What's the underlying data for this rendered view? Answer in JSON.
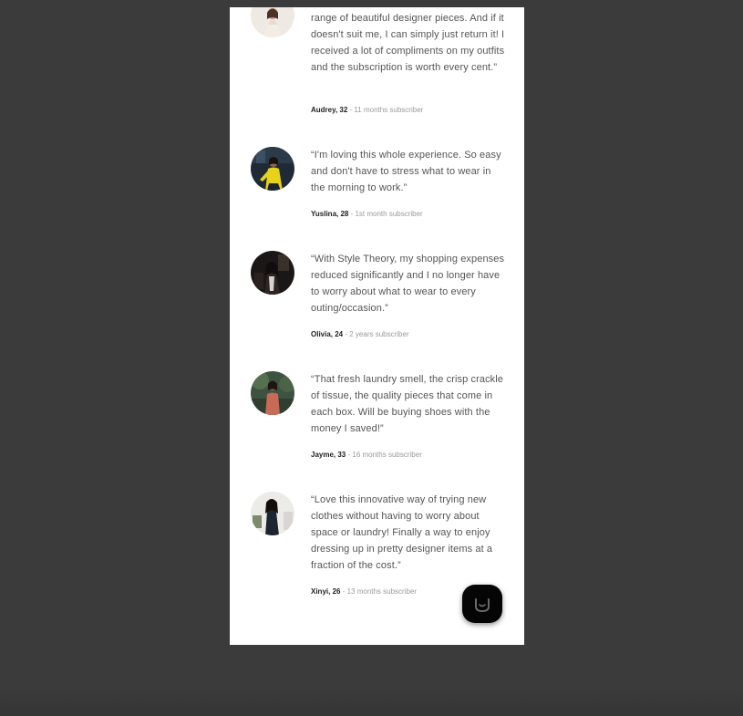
{
  "reviews": [
    {
      "quote": "range of beautiful designer pieces. And if it doesn't suit me, I can simply just return it! I received a lot of compliments on my outfits and the subscription is worth every cent.”",
      "name": "Audrey, 32",
      "tenure": "11 months subscriber"
    },
    {
      "quote": "“I'm loving this whole experience. So easy and don't have to stress what to wear in the morning to work.”",
      "name": "Yuslina, 28",
      "tenure": "1st month subscriber"
    },
    {
      "quote": "“With Style Theory, my shopping expenses reduced significantly and I no longer have to worry about what to wear to every outing/occasion.”",
      "name": "Olivia, 24",
      "tenure": "2 years subscriber"
    },
    {
      "quote": "“That fresh laundry smell, the crisp crackle of tissue, the quality pieces that come in each box. Will be buying shoes with the money I saved!”",
      "name": "Jayme, 33",
      "tenure": "16 months subscriber"
    },
    {
      "quote": "“Love this innovative way of trying new clothes without having to worry about space or laundry! Finally a way to enjoy dressing up in pretty designer items at a fraction of the cost.”",
      "name": "Xinyi, 26",
      "tenure": "13 months subscriber"
    }
  ],
  "separator": " - ",
  "chat_button": {
    "icon": "smile-chat-icon"
  },
  "colors": {
    "backdrop": "#3b3b3b",
    "card": "#ffffff",
    "quote_text": "#555555",
    "name_text": "#222222",
    "tenure_text": "#9a9a9a",
    "chat_button": "#050505"
  }
}
